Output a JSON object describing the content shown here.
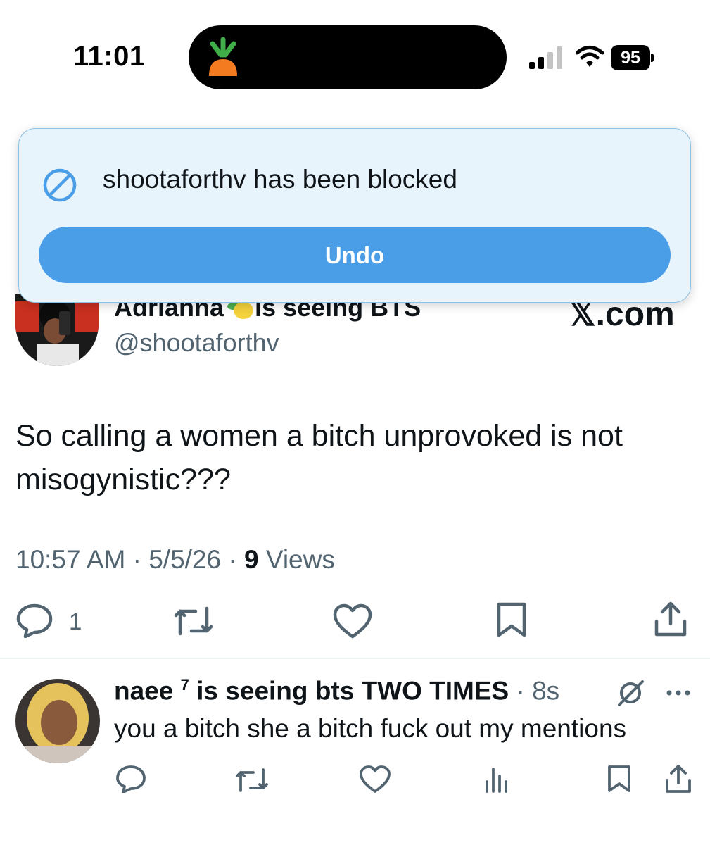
{
  "status_bar": {
    "time": "11:01",
    "battery": "95"
  },
  "colors": {
    "accent": "#4a9de7",
    "toast_bg": "#e8f4fc",
    "secondary_text": "#536471",
    "primary_text": "#0f1419"
  },
  "toast": {
    "message": "shootaforthv has been blocked",
    "undo_label": "Undo",
    "icon": "block-icon"
  },
  "tweet": {
    "display_name_part1": "Adrianna",
    "display_name_part2": "is seeing BTS",
    "handle": "@shootaforthv",
    "watermark": "𝕏.com",
    "text": "So calling a women a bitch unprovoked is not misogynistic???",
    "timestamp": "10:57 AM · 5/5/26 · ",
    "views_count": "9",
    "views_label": " Views",
    "reply_count": "1"
  },
  "reply": {
    "display_name": "naee ",
    "superscript": "7",
    "display_name_rest": " is seeing bts TWO TIMES",
    "time": " · 8s",
    "text": "you a bitch she a bitch fuck out my mentions"
  }
}
